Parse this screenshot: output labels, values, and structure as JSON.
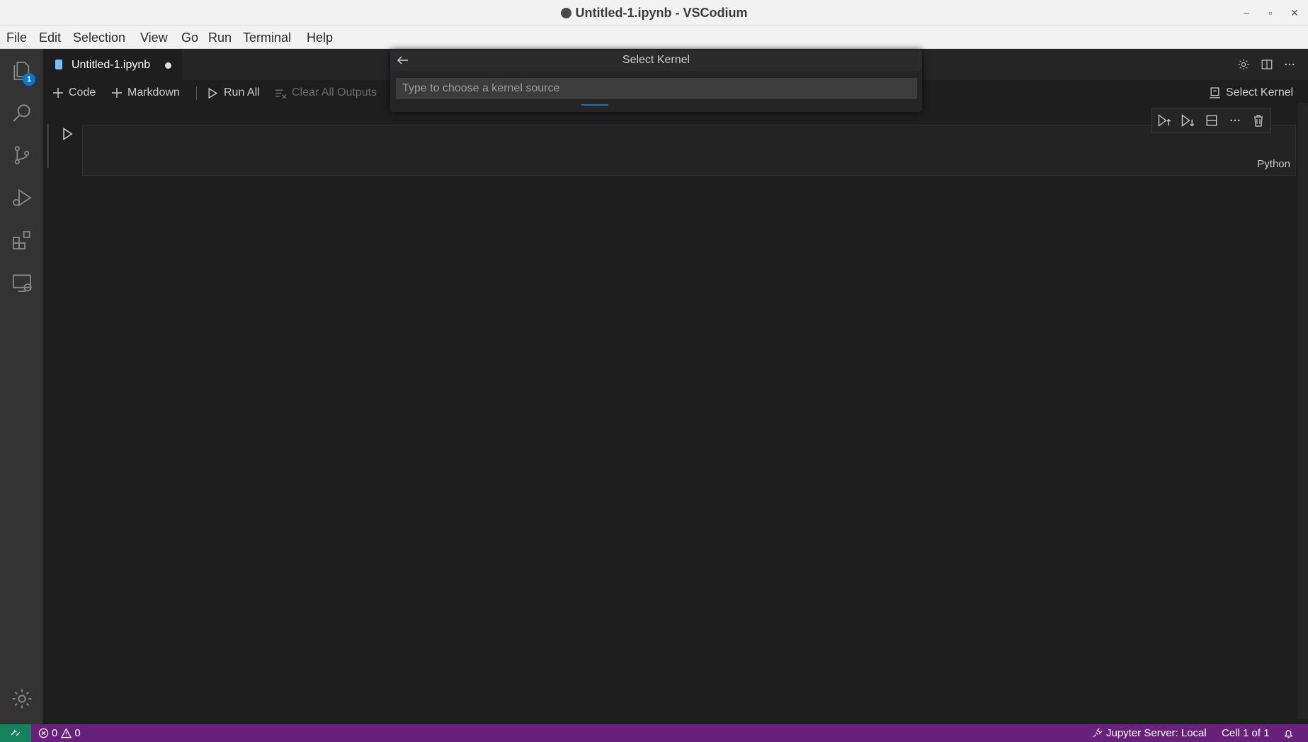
{
  "window": {
    "title": "Untitled-1.ipynb - VSCodium",
    "controls": [
      "minimize-icon",
      "restore-icon",
      "close-icon"
    ]
  },
  "menu": [
    "File",
    "Edit",
    "Selection",
    "View",
    "Go",
    "Run",
    "Terminal",
    "Help"
  ],
  "activity_bar": {
    "items": [
      "explorer-icon",
      "search-icon",
      "source-control-icon",
      "run-debug-icon",
      "extensions-icon",
      "remote-explorer-icon"
    ],
    "explorer_badge": "1",
    "bottom": "gear-icon"
  },
  "tab": {
    "label": "Untitled-1.ipynb",
    "dirty": true
  },
  "notebook_toolbar": {
    "code": "Code",
    "markdown": "Markdown",
    "run_all": "Run All",
    "clear_outputs": "Clear All Outputs",
    "select_kernel": "Select Kernel"
  },
  "cell": {
    "language": "Python"
  },
  "quick_pick": {
    "title": "Select Kernel",
    "placeholder": "Type to choose a kernel source"
  },
  "status_bar": {
    "errors": "0",
    "warnings": "0",
    "jupyter": "Jupyter Server: Local",
    "cell_position": "Cell 1 of 1"
  },
  "colors": {
    "status_bar": "#68217a",
    "remote": "#16825d",
    "accent": "#0078d4"
  }
}
